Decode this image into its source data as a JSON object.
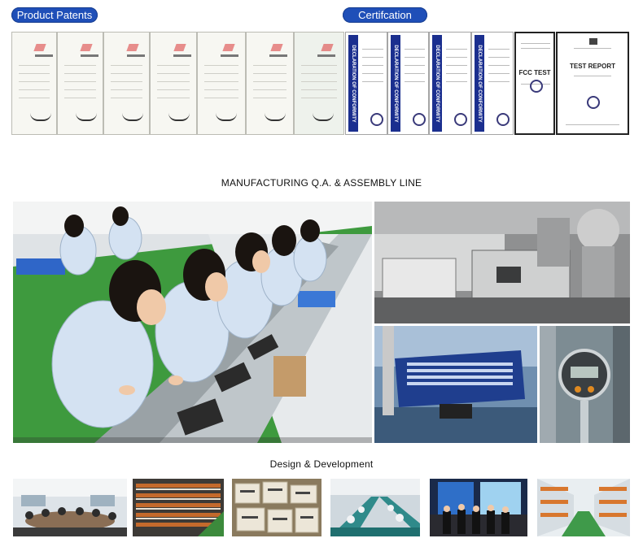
{
  "sections": {
    "patents_label": "Product Patents",
    "cert_label": "Certifcation",
    "manufacturing_heading": "MANUFACTURING Q.A. & ASSEMBLY LINE",
    "design_heading": "Design & Development"
  },
  "certificates": {
    "declaration": "DECLARATION OF CONFORMITY",
    "fcc": "FCC TEST",
    "test_report": "TEST REPORT"
  },
  "colors": {
    "pill": "#1f4fb8",
    "cert_band": "#1b2f8f",
    "floor": "#3a9a3a",
    "uniform": "#d4e2f2"
  }
}
